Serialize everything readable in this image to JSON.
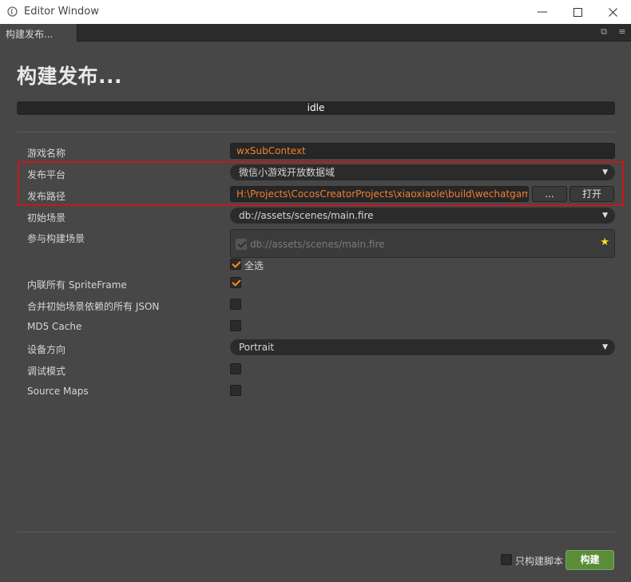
{
  "window": {
    "title": "Editor Window"
  },
  "tab": {
    "label": "构建发布..."
  },
  "page": {
    "title": "构建发布...",
    "status": "idle"
  },
  "fields": {
    "game_name": {
      "label": "游戏名称",
      "value": "wxSubContext"
    },
    "platform": {
      "label": "发布平台",
      "value": "微信小游戏开放数据域"
    },
    "build_path": {
      "label": "发布路径",
      "value": "H:\\Projects\\CocosCreatorProjects\\xiaoxiaole\\build\\wechatgame",
      "browse_label": "...",
      "open_label": "打开"
    },
    "start_scene": {
      "label": "初始场景",
      "value": "db://assets/scenes/main.fire"
    },
    "included_scenes": {
      "label": "参与构建场景",
      "items": [
        {
          "path": "db://assets/scenes/main.fire",
          "checked": true
        }
      ],
      "select_all_label": "全选",
      "select_all_checked": true
    },
    "inline_spriteframe": {
      "label": "内联所有 SpriteFrame",
      "checked": true
    },
    "merge_json": {
      "label": "合并初始场景依赖的所有 JSON",
      "checked": false
    },
    "md5_cache": {
      "label": "MD5 Cache",
      "checked": false
    },
    "orientation": {
      "label": "设备方向",
      "value": "Portrait"
    },
    "debug_mode": {
      "label": "调试模式",
      "checked": false
    },
    "source_maps": {
      "label": "Source Maps",
      "checked": false
    }
  },
  "footer": {
    "scripts_only_label": "只构建脚本",
    "scripts_only_checked": false,
    "build_label": "构建"
  }
}
